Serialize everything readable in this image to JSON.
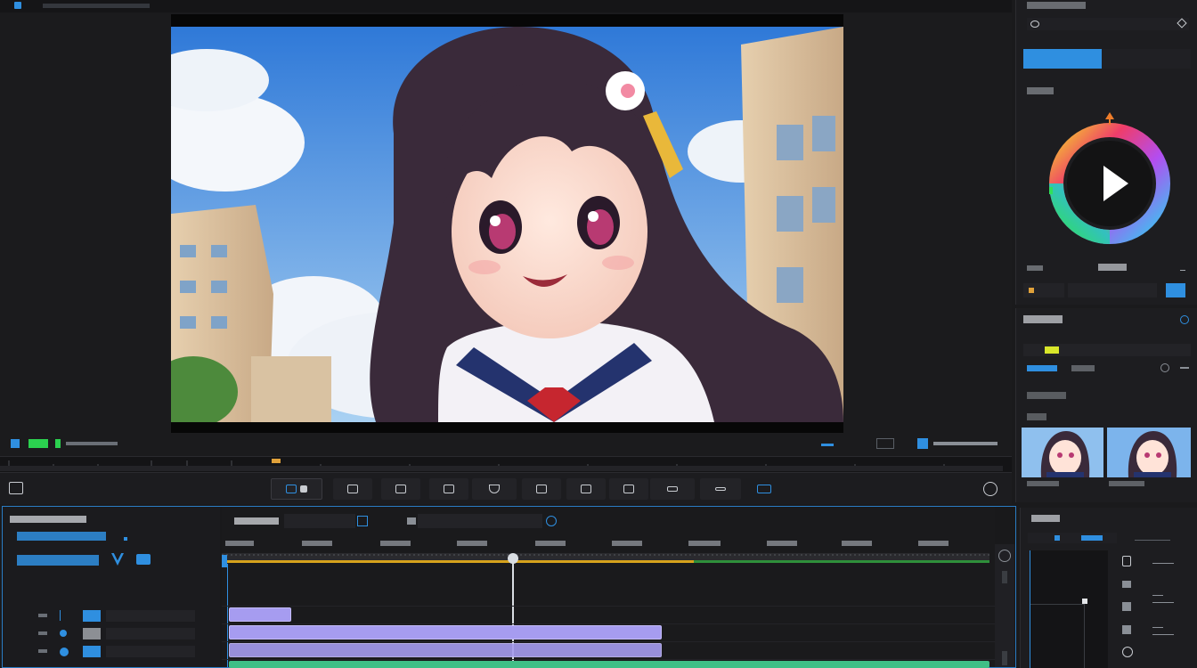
{
  "colors": {
    "accent": "#2f8fe0",
    "clip_purple": "#a69cf0",
    "clip_green": "#3fbf86",
    "progress_yellow": "#d6a21c",
    "progress_green": "#2f8f3a",
    "level_yellow": "#d8e62a",
    "orange_marker": "#ef7d2a"
  },
  "icons": {
    "play": "play-icon",
    "gear": "gear-icon",
    "search": "search-icon",
    "whatsapp": "chat-icon",
    "refresh": "refresh-icon"
  },
  "playhead_position": 0.37,
  "level_meter": 0.08
}
